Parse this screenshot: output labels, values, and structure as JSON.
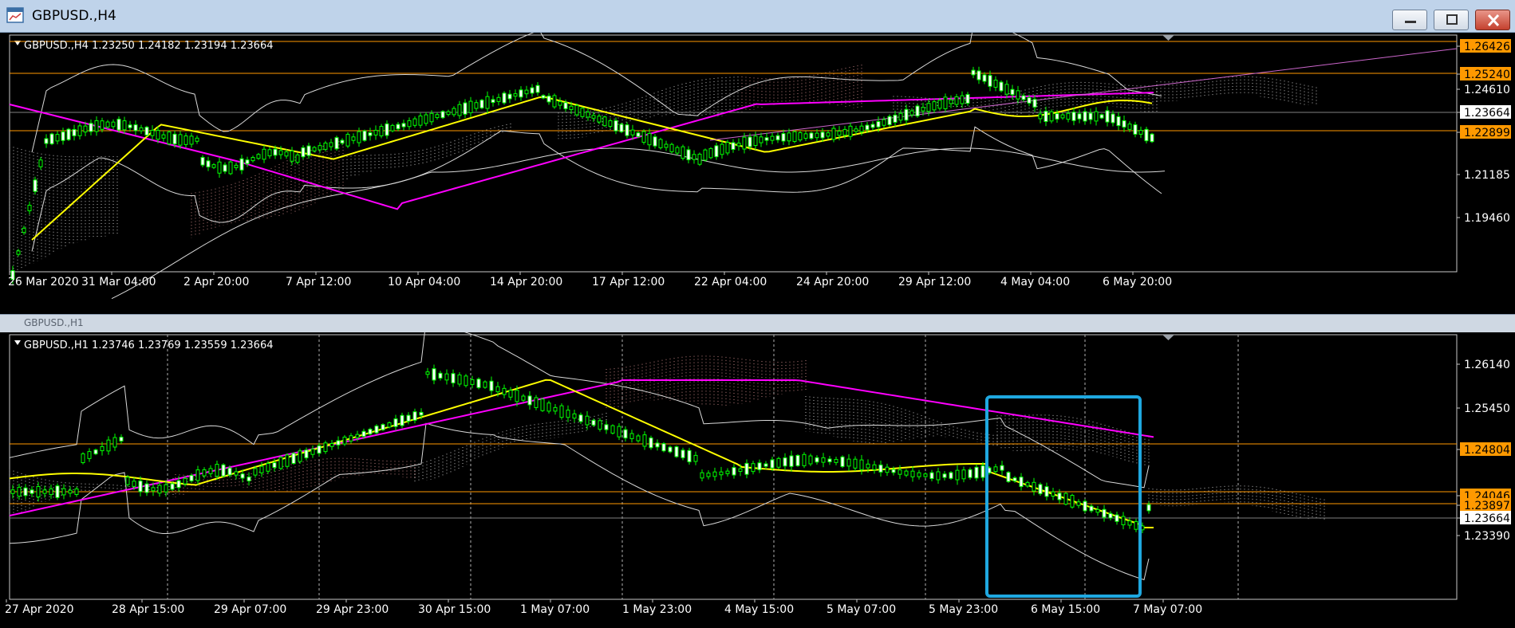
{
  "window": {
    "title": "GBPUSD.,H4",
    "icon": "chart-window-icon"
  },
  "controls": {
    "minimize_icon": "minimize-icon",
    "maximize_icon": "maximize-icon",
    "close_icon": "close-icon"
  },
  "colors": {
    "level_line": "#ff9900",
    "price_tag": "#ff9900",
    "ma_fast": "#ffff00",
    "ma_slow": "#ff00ff",
    "bands": "#d9d9d9",
    "candle": "#00ff00",
    "highlight_box": "#1fa8e0"
  },
  "charts": [
    {
      "id": "h4",
      "header": "GBPUSD.,H4  1.23250 1.24182 1.23194 1.23664",
      "price_labels": [
        "1.26426",
        "1.25240",
        "1.24610",
        "1.23664",
        "1.22899",
        "1.21185",
        "1.19460"
      ],
      "price_highlighted": [
        "1.26426",
        "1.25240",
        "1.22899"
      ],
      "current_price": "1.23664",
      "time_labels": [
        "26 Mar 2020",
        "31 Mar 04:00",
        "2 Apr 20:00",
        "7 Apr 12:00",
        "10 Apr 04:00",
        "14 Apr 20:00",
        "17 Apr 12:00",
        "22 Apr 04:00",
        "24 Apr 20:00",
        "29 Apr 12:00",
        "4 May 04:00",
        "6 May 20:00"
      ]
    },
    {
      "id": "h1",
      "header": "GBPUSD.,H1  1.23746 1.23769 1.23559 1.23664",
      "price_labels": [
        "1.26140",
        "1.25450",
        "1.24804",
        "1.24046",
        "1.23897",
        "1.23664",
        "1.23390"
      ],
      "price_highlighted": [
        "1.24804",
        "1.24046",
        "1.23897"
      ],
      "current_price": "1.23664",
      "time_labels": [
        "27 Apr 2020",
        "28 Apr 15:00",
        "29 Apr 07:00",
        "29 Apr 23:00",
        "30 Apr 15:00",
        "1 May 07:00",
        "1 May 23:00",
        "4 May 15:00",
        "5 May 07:00",
        "5 May 23:00",
        "6 May 15:00",
        "7 May 07:00"
      ]
    }
  ],
  "separator_label": "GBPUSD.,H1"
}
